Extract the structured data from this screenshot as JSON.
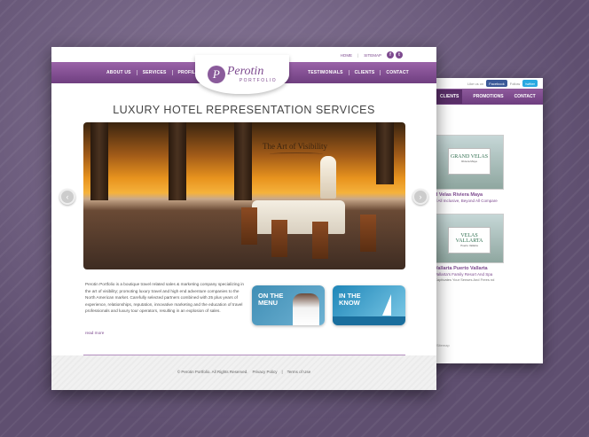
{
  "back_page": {
    "top": {
      "like_text": "Like us on",
      "facebook_label": "Facebook",
      "follow_text": "Follow",
      "twitter_label": "twitter"
    },
    "nav": [
      "CLIENTS",
      "PROMOTIONS",
      "CONTACT"
    ],
    "hotels": [
      {
        "logo_name": "GRAND VELAS",
        "logo_sub": "Riviera Maya",
        "title": "d Velas Riviera Maya",
        "subtitle": "d All Inclusive, Beyond All Compare"
      },
      {
        "logo_name": "VELAS VALLARTA",
        "logo_sub": "Puerto Vallarta",
        "title": "Vallarta Puerto Vallarta",
        "subtitle": "Vallarta's Family Resort And Spa",
        "desc": "Captivates Your Senses And Frees\nnd"
      }
    ],
    "footer": "Sitemap"
  },
  "main_page": {
    "top_links": {
      "home": "HOME",
      "separator": "|",
      "sitemap": "SITEMAP",
      "facebook_glyph": "f",
      "twitter_glyph": "t"
    },
    "nav_left": [
      "ABOUT US",
      "SERVICES",
      "PROFILE"
    ],
    "nav_right": [
      "TESTIMONIALS",
      "CLIENTS",
      "CONTACT"
    ],
    "logo": {
      "mark": "P",
      "script": "Perotin",
      "sub": "PORTFOLIO"
    },
    "heading": "LUXURY HOTEL REPRESENTATION SERVICES",
    "slider": {
      "caption": "The Art of Visibility"
    },
    "arrows": {
      "left": "‹",
      "right": "›"
    },
    "intro": "Perotin Portfolio is a boutique travel related sales & marketing company specializing in the art of visibility; promoting luxury travel and high end adventure companies to the North American market.  Carefully selected partners combined with 25 plus years of experience, relationships, reputation, innovative marketing and the education of travel professionals and luxury tour operators, resulting in an explosion of sales.",
    "read_more": "read more",
    "promos": [
      {
        "line1": "ON THE",
        "line2": "MENU"
      },
      {
        "line1": "IN THE",
        "line2": "KNOW"
      }
    ],
    "footer": {
      "copyright": "© Perotin Portfolio. All Rights Reserved.",
      "privacy": "Privacy Policy",
      "separator": "|",
      "terms": "Terms of Use"
    }
  },
  "colors": {
    "brand_purple": "#7d4a8f",
    "background": "#6b5a7c"
  }
}
